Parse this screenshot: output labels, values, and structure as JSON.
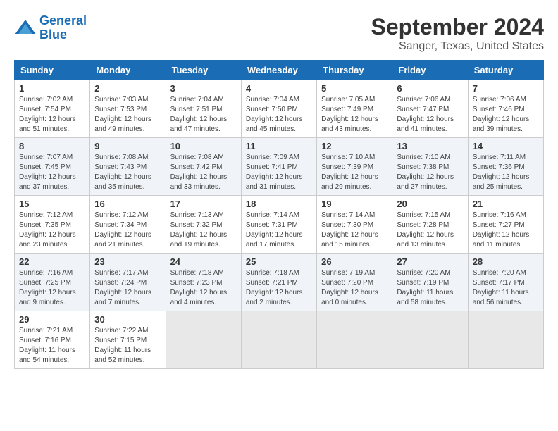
{
  "logo": {
    "line1": "General",
    "line2": "Blue"
  },
  "title": "September 2024",
  "subtitle": "Sanger, Texas, United States",
  "days_of_week": [
    "Sunday",
    "Monday",
    "Tuesday",
    "Wednesday",
    "Thursday",
    "Friday",
    "Saturday"
  ],
  "weeks": [
    [
      {
        "day": "1",
        "sunrise": "Sunrise: 7:02 AM",
        "sunset": "Sunset: 7:54 PM",
        "daylight": "Daylight: 12 hours and 51 minutes."
      },
      {
        "day": "2",
        "sunrise": "Sunrise: 7:03 AM",
        "sunset": "Sunset: 7:53 PM",
        "daylight": "Daylight: 12 hours and 49 minutes."
      },
      {
        "day": "3",
        "sunrise": "Sunrise: 7:04 AM",
        "sunset": "Sunset: 7:51 PM",
        "daylight": "Daylight: 12 hours and 47 minutes."
      },
      {
        "day": "4",
        "sunrise": "Sunrise: 7:04 AM",
        "sunset": "Sunset: 7:50 PM",
        "daylight": "Daylight: 12 hours and 45 minutes."
      },
      {
        "day": "5",
        "sunrise": "Sunrise: 7:05 AM",
        "sunset": "Sunset: 7:49 PM",
        "daylight": "Daylight: 12 hours and 43 minutes."
      },
      {
        "day": "6",
        "sunrise": "Sunrise: 7:06 AM",
        "sunset": "Sunset: 7:47 PM",
        "daylight": "Daylight: 12 hours and 41 minutes."
      },
      {
        "day": "7",
        "sunrise": "Sunrise: 7:06 AM",
        "sunset": "Sunset: 7:46 PM",
        "daylight": "Daylight: 12 hours and 39 minutes."
      }
    ],
    [
      {
        "day": "8",
        "sunrise": "Sunrise: 7:07 AM",
        "sunset": "Sunset: 7:45 PM",
        "daylight": "Daylight: 12 hours and 37 minutes."
      },
      {
        "day": "9",
        "sunrise": "Sunrise: 7:08 AM",
        "sunset": "Sunset: 7:43 PM",
        "daylight": "Daylight: 12 hours and 35 minutes."
      },
      {
        "day": "10",
        "sunrise": "Sunrise: 7:08 AM",
        "sunset": "Sunset: 7:42 PM",
        "daylight": "Daylight: 12 hours and 33 minutes."
      },
      {
        "day": "11",
        "sunrise": "Sunrise: 7:09 AM",
        "sunset": "Sunset: 7:41 PM",
        "daylight": "Daylight: 12 hours and 31 minutes."
      },
      {
        "day": "12",
        "sunrise": "Sunrise: 7:10 AM",
        "sunset": "Sunset: 7:39 PM",
        "daylight": "Daylight: 12 hours and 29 minutes."
      },
      {
        "day": "13",
        "sunrise": "Sunrise: 7:10 AM",
        "sunset": "Sunset: 7:38 PM",
        "daylight": "Daylight: 12 hours and 27 minutes."
      },
      {
        "day": "14",
        "sunrise": "Sunrise: 7:11 AM",
        "sunset": "Sunset: 7:36 PM",
        "daylight": "Daylight: 12 hours and 25 minutes."
      }
    ],
    [
      {
        "day": "15",
        "sunrise": "Sunrise: 7:12 AM",
        "sunset": "Sunset: 7:35 PM",
        "daylight": "Daylight: 12 hours and 23 minutes."
      },
      {
        "day": "16",
        "sunrise": "Sunrise: 7:12 AM",
        "sunset": "Sunset: 7:34 PM",
        "daylight": "Daylight: 12 hours and 21 minutes."
      },
      {
        "day": "17",
        "sunrise": "Sunrise: 7:13 AM",
        "sunset": "Sunset: 7:32 PM",
        "daylight": "Daylight: 12 hours and 19 minutes."
      },
      {
        "day": "18",
        "sunrise": "Sunrise: 7:14 AM",
        "sunset": "Sunset: 7:31 PM",
        "daylight": "Daylight: 12 hours and 17 minutes."
      },
      {
        "day": "19",
        "sunrise": "Sunrise: 7:14 AM",
        "sunset": "Sunset: 7:30 PM",
        "daylight": "Daylight: 12 hours and 15 minutes."
      },
      {
        "day": "20",
        "sunrise": "Sunrise: 7:15 AM",
        "sunset": "Sunset: 7:28 PM",
        "daylight": "Daylight: 12 hours and 13 minutes."
      },
      {
        "day": "21",
        "sunrise": "Sunrise: 7:16 AM",
        "sunset": "Sunset: 7:27 PM",
        "daylight": "Daylight: 12 hours and 11 minutes."
      }
    ],
    [
      {
        "day": "22",
        "sunrise": "Sunrise: 7:16 AM",
        "sunset": "Sunset: 7:25 PM",
        "daylight": "Daylight: 12 hours and 9 minutes."
      },
      {
        "day": "23",
        "sunrise": "Sunrise: 7:17 AM",
        "sunset": "Sunset: 7:24 PM",
        "daylight": "Daylight: 12 hours and 7 minutes."
      },
      {
        "day": "24",
        "sunrise": "Sunrise: 7:18 AM",
        "sunset": "Sunset: 7:23 PM",
        "daylight": "Daylight: 12 hours and 4 minutes."
      },
      {
        "day": "25",
        "sunrise": "Sunrise: 7:18 AM",
        "sunset": "Sunset: 7:21 PM",
        "daylight": "Daylight: 12 hours and 2 minutes."
      },
      {
        "day": "26",
        "sunrise": "Sunrise: 7:19 AM",
        "sunset": "Sunset: 7:20 PM",
        "daylight": "Daylight: 12 hours and 0 minutes."
      },
      {
        "day": "27",
        "sunrise": "Sunrise: 7:20 AM",
        "sunset": "Sunset: 7:19 PM",
        "daylight": "Daylight: 11 hours and 58 minutes."
      },
      {
        "day": "28",
        "sunrise": "Sunrise: 7:20 AM",
        "sunset": "Sunset: 7:17 PM",
        "daylight": "Daylight: 11 hours and 56 minutes."
      }
    ],
    [
      {
        "day": "29",
        "sunrise": "Sunrise: 7:21 AM",
        "sunset": "Sunset: 7:16 PM",
        "daylight": "Daylight: 11 hours and 54 minutes."
      },
      {
        "day": "30",
        "sunrise": "Sunrise: 7:22 AM",
        "sunset": "Sunset: 7:15 PM",
        "daylight": "Daylight: 11 hours and 52 minutes."
      },
      null,
      null,
      null,
      null,
      null
    ]
  ]
}
